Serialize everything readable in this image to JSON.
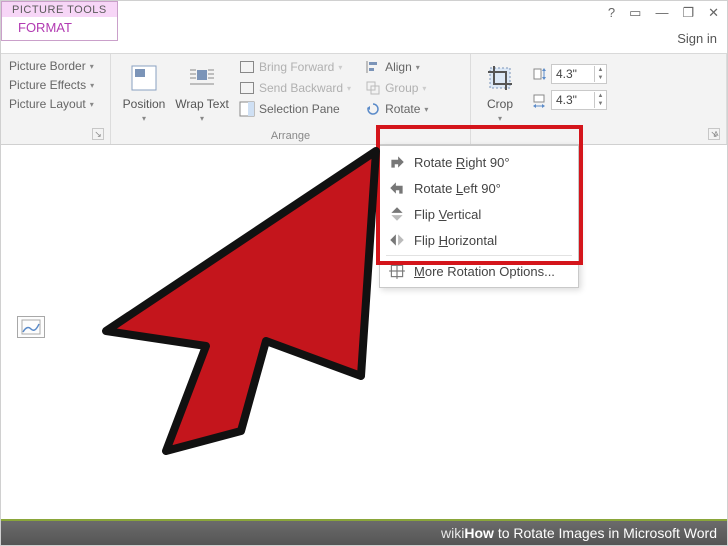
{
  "window": {
    "help": "?",
    "ribbon_opts": "▭",
    "minimize": "—",
    "restore": "❐",
    "close": "✕"
  },
  "context_tab": {
    "top": "PICTURE TOOLS",
    "bottom": "FORMAT"
  },
  "sign_in": "Sign in",
  "styles_group": {
    "border": "Picture Border",
    "effects": "Picture Effects",
    "layout": "Picture Layout"
  },
  "arrange_group": {
    "label": "Arrange",
    "position": "Position",
    "wrap": "Wrap Text",
    "bring_forward": "Bring Forward",
    "send_backward": "Send Backward",
    "selection_pane": "Selection Pane",
    "align": "Align",
    "group": "Group",
    "rotate": "Rotate"
  },
  "crop_group": {
    "crop": "Crop",
    "height": "4.3\"",
    "width": "4.3\""
  },
  "rotate_menu": {
    "rr90_pre": "Rotate ",
    "rr90_key": "R",
    "rr90_post": "ight 90°",
    "rl90_pre": "Rotate ",
    "rl90_key": "L",
    "rl90_post": "eft 90°",
    "fv_pre": "Flip ",
    "fv_key": "V",
    "fv_post": "ertical",
    "fh_pre": "Flip ",
    "fh_key": "H",
    "fh_post": "orizontal",
    "more_key": "M",
    "more_post": "ore Rotation Options..."
  },
  "caption": {
    "wiki": "wiki",
    "how": "How",
    "text": " to Rotate Images in Microsoft Word"
  }
}
